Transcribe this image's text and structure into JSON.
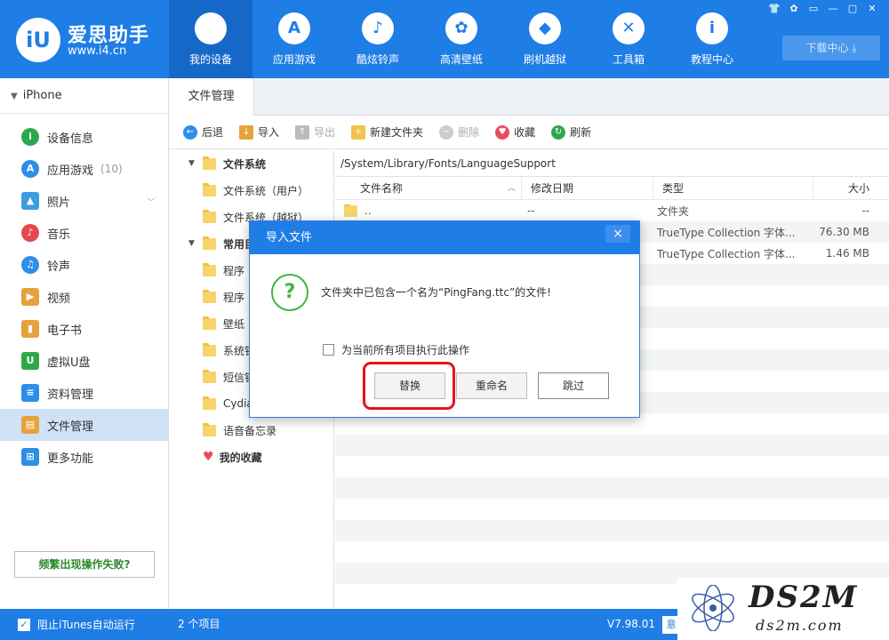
{
  "app": {
    "logo_glyph": "iU",
    "name": "爱思助手",
    "url": "www.i4.cn"
  },
  "nav": [
    {
      "label": "我的设备",
      "icon": "apple-icon",
      "glyph": "",
      "active": true
    },
    {
      "label": "应用游戏",
      "icon": "app-store-icon",
      "glyph": "A"
    },
    {
      "label": "酷炫铃声",
      "icon": "bell-icon",
      "glyph": "♪"
    },
    {
      "label": "高清壁纸",
      "icon": "flower-icon",
      "glyph": "✿"
    },
    {
      "label": "刷机越狱",
      "icon": "dropbox-icon",
      "glyph": "◆"
    },
    {
      "label": "工具箱",
      "icon": "tools-icon",
      "glyph": "✕"
    },
    {
      "label": "教程中心",
      "icon": "info-icon",
      "glyph": "i"
    }
  ],
  "header": {
    "download_center": "下载中心 ⤓"
  },
  "window_controls": [
    "👕",
    "✿",
    "▭",
    "—",
    "▢",
    "✕"
  ],
  "sidebar": {
    "device": "iPhone",
    "items": [
      {
        "label": "设备信息",
        "icon": "info-icon",
        "color": "#2ea84a",
        "glyph": "i"
      },
      {
        "label": "应用游戏",
        "icon": "app-store-icon",
        "color": "#2d8fe8",
        "glyph": "A",
        "count": "(10)"
      },
      {
        "label": "照片",
        "icon": "photo-icon",
        "color": "#3e9de0",
        "glyph": "▲",
        "square": true,
        "chevron": true
      },
      {
        "label": "音乐",
        "icon": "music-icon",
        "color": "#e8474f",
        "glyph": "♪"
      },
      {
        "label": "铃声",
        "icon": "bell-icon",
        "color": "#2d8fe8",
        "glyph": "♫"
      },
      {
        "label": "视频",
        "icon": "video-icon",
        "color": "#e8a23b",
        "glyph": "▶",
        "square": true
      },
      {
        "label": "电子书",
        "icon": "book-icon",
        "color": "#e8a23b",
        "glyph": "▮",
        "square": true
      },
      {
        "label": "虚拟U盘",
        "icon": "usb-icon",
        "color": "#2ea84a",
        "glyph": "U",
        "square": true
      },
      {
        "label": "资料管理",
        "icon": "contacts-icon",
        "color": "#2d8fe8",
        "glyph": "≡",
        "square": true
      },
      {
        "label": "文件管理",
        "icon": "files-icon",
        "color": "#e8a23b",
        "glyph": "▤",
        "square": true,
        "active": true
      },
      {
        "label": "更多功能",
        "icon": "more-icon",
        "color": "#2d8fe8",
        "glyph": "⊞",
        "square": true
      }
    ],
    "help_button": "频繁出现操作失败?"
  },
  "tabs": [
    "文件管理"
  ],
  "toolbar": [
    {
      "label": "后退",
      "icon": "back-icon",
      "color": "#2d8fe8",
      "glyph": "←"
    },
    {
      "label": "导入",
      "icon": "import-icon",
      "color": "#e8a23b",
      "glyph": "↓",
      "square": true
    },
    {
      "label": "导出",
      "icon": "export-icon",
      "color": "#bbbbbb",
      "glyph": "↑",
      "square": true,
      "disabled": true
    },
    {
      "label": "新建文件夹",
      "icon": "new-folder-icon",
      "color": "#f2c24a",
      "glyph": "+",
      "square": true
    },
    {
      "label": "删除",
      "icon": "delete-icon",
      "color": "#cccccc",
      "glyph": "−",
      "disabled": true
    },
    {
      "label": "收藏",
      "icon": "heart-icon",
      "color": "#e84c5a",
      "glyph": "♥"
    },
    {
      "label": "刷新",
      "icon": "refresh-icon",
      "color": "#2ea84a",
      "glyph": "↻"
    }
  ],
  "tree": [
    {
      "label": "文件系统",
      "level": 0,
      "caret": "▼",
      "folder": true
    },
    {
      "label": "文件系统（用户）",
      "level": 1,
      "folder": true
    },
    {
      "label": "文件系统（越狱）",
      "level": 1,
      "folder": true
    },
    {
      "label": "常用目录",
      "level": 0,
      "caret": "▼",
      "folder": true
    },
    {
      "label": "程序",
      "level": 1,
      "folder": true
    },
    {
      "label": "程序",
      "level": 1,
      "folder": true
    },
    {
      "label": "壁纸",
      "level": 1,
      "folder": true
    },
    {
      "label": "系统铃声",
      "level": 1,
      "folder": true
    },
    {
      "label": "短信铃声",
      "level": 1,
      "folder": true
    },
    {
      "label": "Cydia",
      "level": 1,
      "folder": true
    },
    {
      "label": "语音备忘录",
      "level": 1,
      "folder": true
    },
    {
      "label": "我的收藏",
      "level": 0,
      "heart": true
    }
  ],
  "file_pane": {
    "path": "/System/Library/Fonts/LanguageSupport",
    "columns": {
      "name": "文件名称",
      "sort": "︿",
      "date": "修改日期",
      "type": "类型",
      "size": "大小"
    },
    "rows": [
      {
        "name": "..",
        "date": "--",
        "type": "文件夹",
        "size": "--",
        "folder": true
      },
      {
        "name": "",
        "date": "",
        "type": "TrueType Collection 字体...",
        "size": "76.30 MB"
      },
      {
        "name": "",
        "date": "",
        "type": "TrueType Collection 字体...",
        "size": "1.46 MB"
      },
      {},
      {},
      {},
      {},
      {},
      {},
      {},
      {},
      {},
      {},
      {},
      {},
      {},
      {},
      {},
      {}
    ]
  },
  "dialog": {
    "title": "导入文件",
    "close": "×",
    "icon_glyph": "?",
    "message": "文件夹中已包含一个名为“PingFang.ttc”的文件!",
    "checkbox_label": "为当前所有项目执行此操作",
    "buttons": {
      "replace": "替换",
      "rename": "重命名",
      "skip": "跳过"
    }
  },
  "status": {
    "checkbox_label": "阻止iTunes自动运行",
    "checkbox_mark": "✓",
    "item_count": "2 个项目",
    "version": "V7.98.01",
    "button": "意"
  },
  "watermark": {
    "text": "DS2M",
    "sub": "ds2m.com"
  }
}
